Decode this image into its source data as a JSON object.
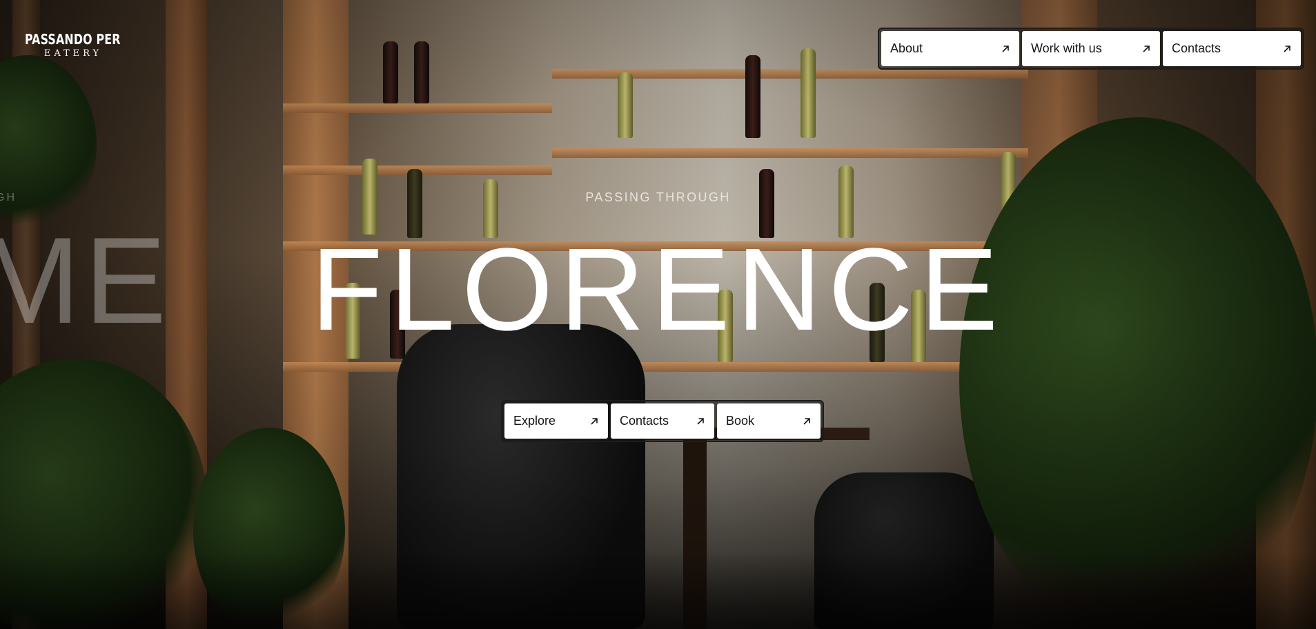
{
  "brand": {
    "name": "PASSANDO PER",
    "subtitle": "EATERY"
  },
  "top_nav": {
    "items": [
      {
        "label": "About",
        "icon": "arrow-up-right-icon"
      },
      {
        "label": "Work with us",
        "icon": "arrow-up-right-icon"
      },
      {
        "label": "Contacts",
        "icon": "arrow-up-right-icon"
      }
    ]
  },
  "hero": {
    "kicker": "PASSING THROUGH",
    "title": "FLORENCE",
    "ghost_kicker": "GH",
    "ghost_title": "ME",
    "background": "restaurant interior with wooden wine shelves, leather armchairs and plants"
  },
  "cta": {
    "items": [
      {
        "label": "Explore",
        "icon": "arrow-up-right-icon"
      },
      {
        "label": "Contacts",
        "icon": "arrow-up-right-icon"
      },
      {
        "label": "Book",
        "icon": "arrow-up-right-icon"
      }
    ]
  },
  "colors": {
    "button_bg": "#ffffff",
    "button_text": "#151515",
    "hero_text": "#ffffff"
  }
}
